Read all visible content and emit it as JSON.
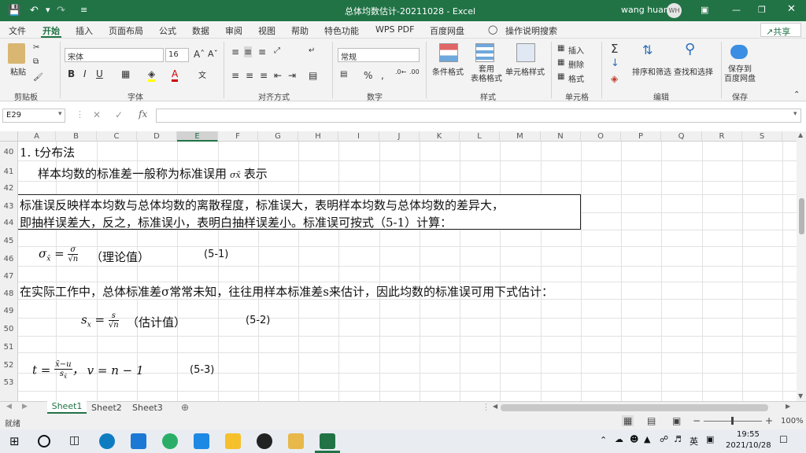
{
  "titlebar": {
    "doc_title": "总体均数估计-20211028  -  Excel",
    "user": "wang huan",
    "avatar_initials": "WH"
  },
  "menu": [
    "文件",
    "开始",
    "插入",
    "页面布局",
    "公式",
    "数据",
    "审阅",
    "视图",
    "帮助",
    "特色功能",
    "WPS PDF",
    "百度网盘"
  ],
  "tell_me": "操作说明搜索",
  "share": "共享",
  "ribbon": {
    "paste": "粘贴",
    "font_name": "宋体",
    "font_size": "16",
    "number_format": "常规",
    "cond_format": "条件格式",
    "table_format": "套用\n表格格式",
    "cell_style": "单元格样式",
    "insert": "插入",
    "delete": "删除",
    "format": "格式",
    "sort_filter": "排序和筛选",
    "find_select": "查找和选择",
    "save_baidu": "保存到\n百度网盘",
    "groups": [
      "剪贴板",
      "字体",
      "对齐方式",
      "数字",
      "样式",
      "单元格",
      "编辑",
      "保存"
    ]
  },
  "namebox": "E29",
  "formula": "",
  "columns": [
    "A",
    "B",
    "C",
    "D",
    "E",
    "F",
    "G",
    "H",
    "I",
    "J",
    "K",
    "L",
    "M",
    "N",
    "O",
    "P",
    "Q",
    "R",
    "S"
  ],
  "rows": [
    "40",
    "41",
    "42",
    "43",
    "44",
    "45",
    "46",
    "47",
    "48",
    "49",
    "50",
    "51",
    "52",
    "53"
  ],
  "cells": {
    "r40": "1.  t分布法",
    "r41a": "样本均数的标准差一般称为标准误用",
    "r41sym": "σx̄",
    "r41b": "表示",
    "r43": "标准误反映样本均数与总体均数的离散程度，标准误大，表明样本均数与总体均数的差异大，",
    "r44": "即抽样误差大，反之，标准误小，表明白抽样误差小。标准误可按式（5-1）计算：",
    "r46_label": "（理论值）",
    "r46_no": "(5-1)",
    "r48": "在实际工作中，总体标准差σ常常未知，往往用样本标准差s来估计，因此均数的标准误可用下式估计：",
    "r50_label": "（估计值）",
    "r50_no": "(5-2)",
    "r52_no": "(5-3)"
  },
  "sheets": [
    "Sheet1",
    "Sheet2",
    "Sheet3"
  ],
  "status": {
    "mode": "就绪",
    "zoom": "100%"
  },
  "taskbar": {
    "ime": "英",
    "time": "19:55",
    "date": "2021/10/28"
  },
  "colors": {
    "excel_green": "#217346"
  }
}
